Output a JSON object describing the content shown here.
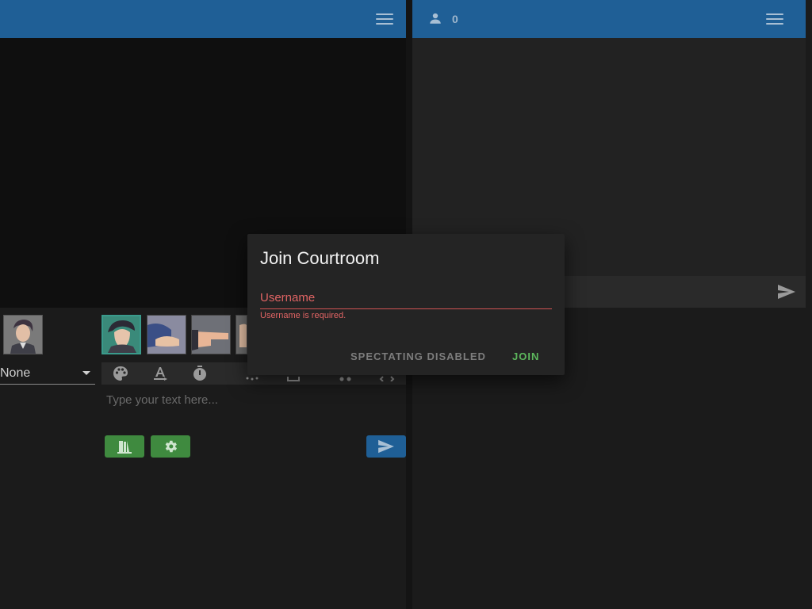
{
  "header": {
    "user_count": "0"
  },
  "composer": {
    "color_select": "None",
    "text_placeholder": "Type your text here..."
  },
  "dialog": {
    "title": "Join Courtroom",
    "username_label": "Username",
    "username_value": "",
    "username_error": "Username is required.",
    "spectate_label": "SPECTATING DISABLED",
    "join_label": "JOIN"
  },
  "colors": {
    "appbar": "#1f5f96",
    "error": "#e06464",
    "join": "#5db85d",
    "action_green": "#3f8a3f"
  },
  "icons": {
    "left_menu": "hamburger-menu-icon",
    "right_menu": "hamburger-menu-icon",
    "user": "person-icon",
    "send": "send-icon",
    "toolbar": [
      "palette-icon",
      "text-color-icon",
      "timer-icon",
      "effects-icon",
      "crop-icon",
      "music-icon",
      "code-icon"
    ],
    "evidence": "evidence-icon",
    "settings": "gear-icon"
  }
}
